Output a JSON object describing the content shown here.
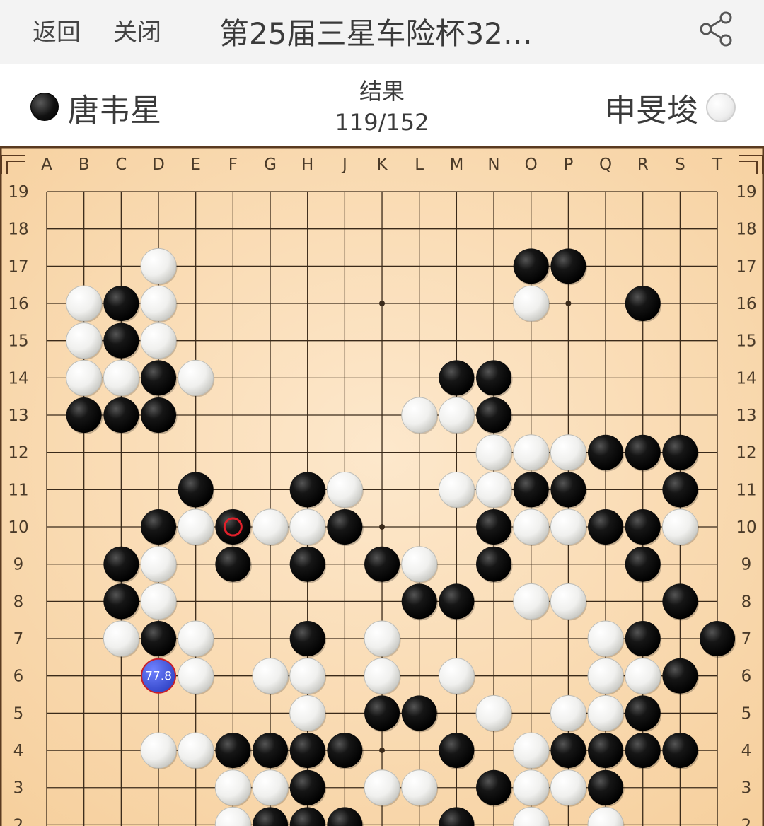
{
  "topbar": {
    "back_label": "返回",
    "close_label": "关闭",
    "title": "第25届三星车险杯32…"
  },
  "players": {
    "black_name": "唐韦星",
    "white_name": "申旻埈"
  },
  "status": {
    "label": "结果",
    "move_count": "119/152"
  },
  "board": {
    "size": 19,
    "columns": [
      "A",
      "B",
      "C",
      "D",
      "E",
      "F",
      "G",
      "H",
      "J",
      "K",
      "L",
      "M",
      "N",
      "O",
      "P",
      "Q",
      "R",
      "S",
      "T"
    ],
    "rows": [
      "19",
      "18",
      "17",
      "16",
      "15",
      "14",
      "13",
      "12",
      "11",
      "10",
      "9",
      "8",
      "7",
      "6",
      "5",
      "4",
      "3",
      "2"
    ],
    "star_points": [
      "K16",
      "P16",
      "K10",
      "K4"
    ],
    "black_stones": [
      "C16",
      "C15",
      "D14",
      "B13",
      "C13",
      "D13",
      "M14",
      "N14",
      "N13",
      "O17",
      "P17",
      "R16",
      "Q12",
      "R12",
      "S12",
      "S11",
      "O11",
      "P11",
      "E11",
      "H11",
      "D10",
      "F10",
      "J10",
      "N10",
      "Q10",
      "R10",
      "C9",
      "F9",
      "H9",
      "K9",
      "N9",
      "R9",
      "C8",
      "L8",
      "M8",
      "S8",
      "D7",
      "H7",
      "R7",
      "T7",
      "S6",
      "K5",
      "L5",
      "R5",
      "F4",
      "G4",
      "H4",
      "J4",
      "M4",
      "P4",
      "Q4",
      "R4",
      "S4",
      "H3",
      "N3",
      "Q3",
      "G2",
      "H2",
      "J2",
      "M2"
    ],
    "white_stones": [
      "D17",
      "B16",
      "D16",
      "O16",
      "B15",
      "D15",
      "B14",
      "C14",
      "E14",
      "L13",
      "M13",
      "N12",
      "O12",
      "P12",
      "J11",
      "M11",
      "N11",
      "E10",
      "G10",
      "H10",
      "O10",
      "P10",
      "S10",
      "D9",
      "L9",
      "D8",
      "O8",
      "P8",
      "C7",
      "E7",
      "K7",
      "Q7",
      "E6",
      "G6",
      "H6",
      "K6",
      "M6",
      "Q6",
      "R6",
      "H5",
      "N5",
      "P5",
      "Q5",
      "D4",
      "E4",
      "O4",
      "F3",
      "G3",
      "K3",
      "L3",
      "O3",
      "P3",
      "F2",
      "O2",
      "Q2"
    ],
    "last_move": "F10",
    "marker": {
      "point": "D6",
      "value": "77.8",
      "color": "#3b4fcf"
    }
  }
}
